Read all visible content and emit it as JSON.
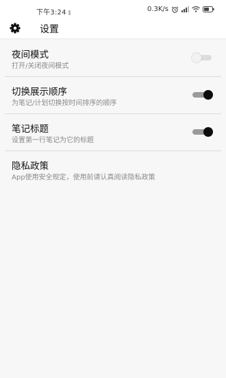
{
  "status_bar": {
    "time": "下午3:24",
    "speed": "0.3K/s",
    "icons": [
      "alarm-icon",
      "signal-icon",
      "wifi-icon",
      "battery-icon"
    ]
  },
  "toolbar": {
    "icon": "gear-icon",
    "title": "设置"
  },
  "settings": [
    {
      "title": "夜间模式",
      "desc": "打开/关闭夜间模式",
      "toggle": "off"
    },
    {
      "title": "切换展示顺序",
      "desc": "为笔记/计划切换按时间排序的顺序",
      "toggle": "on"
    },
    {
      "title": "笔记标题",
      "desc": "设置第一行笔记为它的标题",
      "toggle": "on"
    },
    {
      "title": "隐私政策",
      "desc": "App使用安全规定，使用前请认真阅读隐私政策",
      "toggle": null
    }
  ]
}
